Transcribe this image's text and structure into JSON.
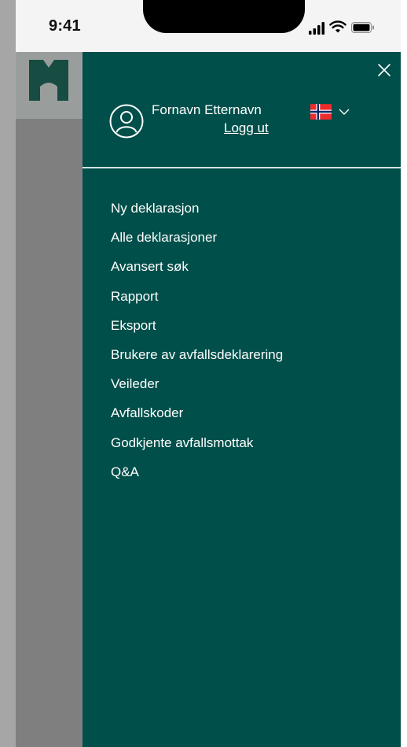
{
  "status_bar": {
    "time": "9:41",
    "icons": [
      "signal-icon",
      "wifi-icon",
      "battery-icon"
    ]
  },
  "underlay": {
    "logo_icon": "logo-icon"
  },
  "drawer": {
    "close_icon": "close-icon",
    "user": {
      "name": "Fornavn Etternavn",
      "logout_label": "Logg ut",
      "icon": "user-icon"
    },
    "language": {
      "flag_icon": "norway-flag-icon",
      "dropdown_icon": "chevron-down-icon"
    },
    "menu_items": [
      {
        "label": "Ny deklarasjon"
      },
      {
        "label": "Alle deklarasjoner"
      },
      {
        "label": "Avansert søk"
      },
      {
        "label": "Rapport"
      },
      {
        "label": "Eksport"
      },
      {
        "label": "Brukere av avfallsdeklarering"
      },
      {
        "label": "Veileder"
      },
      {
        "label": "Avfallskoder"
      },
      {
        "label": "Godkjente avfallsmottak"
      },
      {
        "label": "Q&A"
      }
    ]
  },
  "colors": {
    "drawer_background": "#004f4a",
    "drawer_text": "#ffffff",
    "overlay_dim": "#7f7f7f"
  }
}
